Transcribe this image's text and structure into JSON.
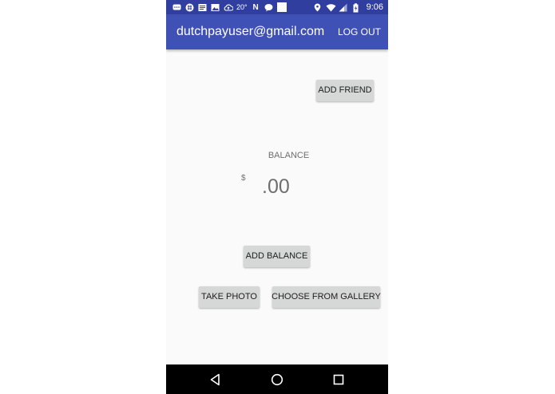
{
  "status_bar": {
    "temperature": "20°",
    "time": "9:06",
    "left_icons": [
      "chat-icon",
      "slack-icon",
      "news-icon",
      "image-icon",
      "cloud-upload-icon",
      "weather-icon",
      "n-icon",
      "chat-bubble-icon",
      "blank-square-icon"
    ],
    "right_icons": [
      "location-icon",
      "wifi-icon",
      "signal-icon",
      "battery-charging-icon"
    ]
  },
  "app_bar": {
    "title": "dutchpayuser@gmail.com",
    "logout_label": "LOG OUT",
    "background": "#3f51b5",
    "status_background": "#303f9f"
  },
  "main": {
    "add_friend_label": "ADD FRIEND",
    "balance_label": "BALANCE",
    "currency_symbol": "$",
    "balance_value": ".00",
    "add_balance_label": "ADD BALANCE",
    "take_photo_label": "TAKE PHOTO",
    "choose_gallery_label": "CHOOSE FROM GALLERY"
  },
  "nav_bar": {
    "icons": [
      "back-icon",
      "home-icon",
      "recents-icon"
    ]
  }
}
